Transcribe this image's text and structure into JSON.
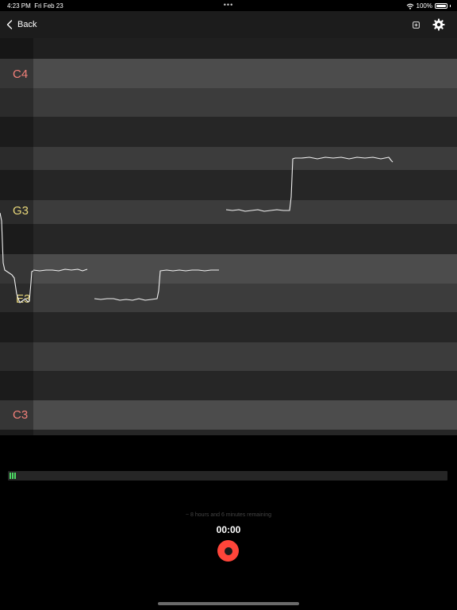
{
  "status_bar": {
    "time": "4:23 PM",
    "date": "Fri Feb 23",
    "dots": "•••",
    "battery_text": "100%"
  },
  "nav": {
    "back_label": "Back",
    "export_icon": "square-plus-icon",
    "settings_icon": "gear-icon"
  },
  "notes": {
    "c4": "C4",
    "g3": "G3",
    "e3": "E3",
    "c3": "C3"
  },
  "colors": {
    "c_note": "#f2807a",
    "other_note": "#e8d77a",
    "record": "#ff453a",
    "level": "#4cd964"
  },
  "recording": {
    "remaining_text": "~ 8 hours and 6 minutes remaining",
    "elapsed": "00:00"
  }
}
